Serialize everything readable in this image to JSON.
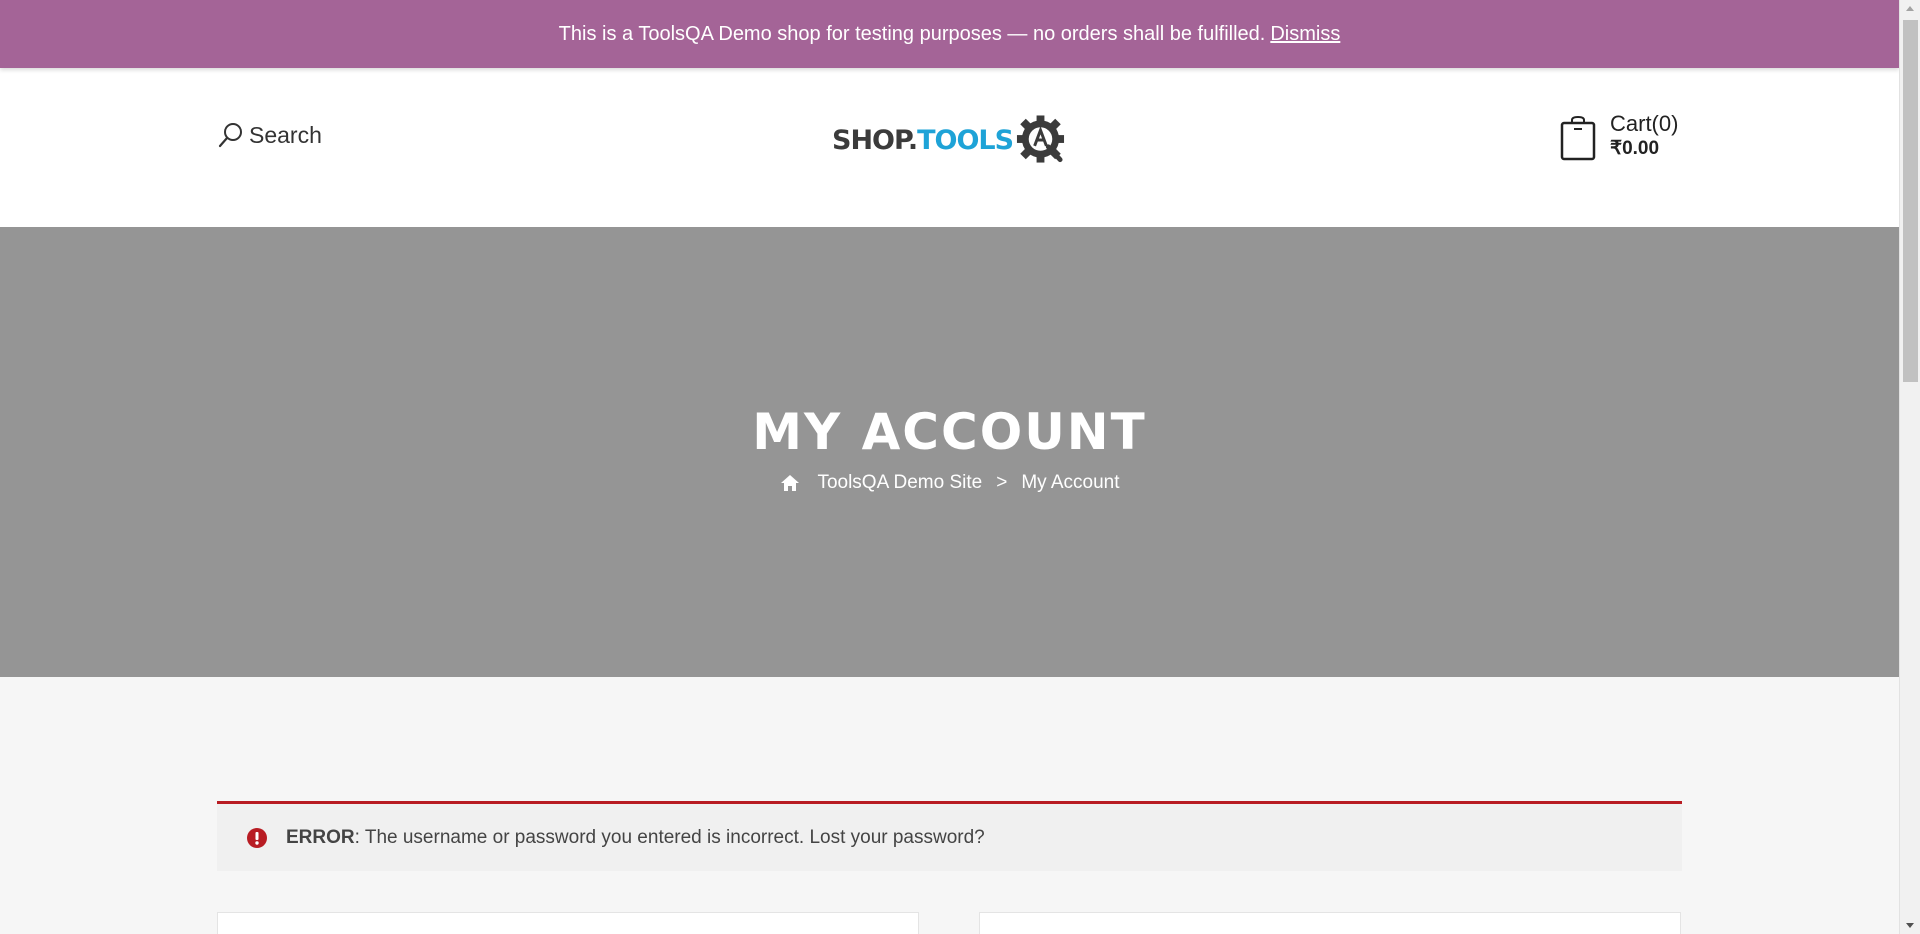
{
  "notice": {
    "text": "This is a ToolsQA Demo shop for testing purposes — no orders shall be fulfilled.",
    "dismiss_label": "Dismiss",
    "background_color": "#a46497"
  },
  "header": {
    "search_label": "Search",
    "logo": {
      "part1": "SHOP.",
      "part2": "TOOLS",
      "gear_letter": "A"
    },
    "cart": {
      "label": "Cart(0)",
      "total": "₹0.00"
    }
  },
  "hero": {
    "title": "MY ACCOUNT",
    "breadcrumb": {
      "home_label": "ToolsQA Demo Site",
      "separator": ">",
      "current": "My Account"
    }
  },
  "error": {
    "label": "ERROR",
    "message": ": The username or password you entered is incorrect. Lost your password?",
    "color": "#b81c23"
  },
  "icons": {
    "search": "search-icon",
    "cart": "shopping-bag-icon",
    "home": "home-icon",
    "error": "exclamation-circle-icon"
  }
}
